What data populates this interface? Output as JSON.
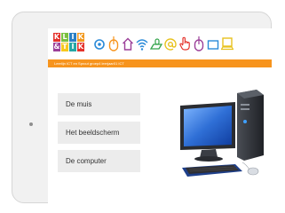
{
  "brand": {
    "logo_top": [
      "K",
      "L",
      "I",
      "K"
    ],
    "logo_bottom": [
      "&",
      "T",
      "I",
      "K"
    ],
    "tagline": "Leerlijn ICT en Sprout groep4 leerjaar01 ICT"
  },
  "toolbar_icons": [
    "gear-icon",
    "mouse-icon",
    "home-icon",
    "wifi-icon",
    "mouse-pad-icon",
    "at-sign-icon",
    "pointer-hand-icon",
    "mouse-icon",
    "window-icon",
    "monitor-icon"
  ],
  "menu": {
    "items": [
      {
        "label": "De muis"
      },
      {
        "label": "Het beeldscherm"
      },
      {
        "label": "De computer"
      }
    ]
  },
  "illustration": {
    "name": "desktop-computer-illustration"
  },
  "colors": {
    "accent": "#f7941d",
    "button_bg": "#ececec",
    "icon_green": "#33a34a",
    "icon_blue": "#2a8ad8",
    "icon_orange": "#f7941d",
    "icon_purple": "#9b3f98",
    "icon_yellow": "#e8c21e",
    "monitor_screen": "#2f6fd6",
    "tower": "#2f3238"
  }
}
